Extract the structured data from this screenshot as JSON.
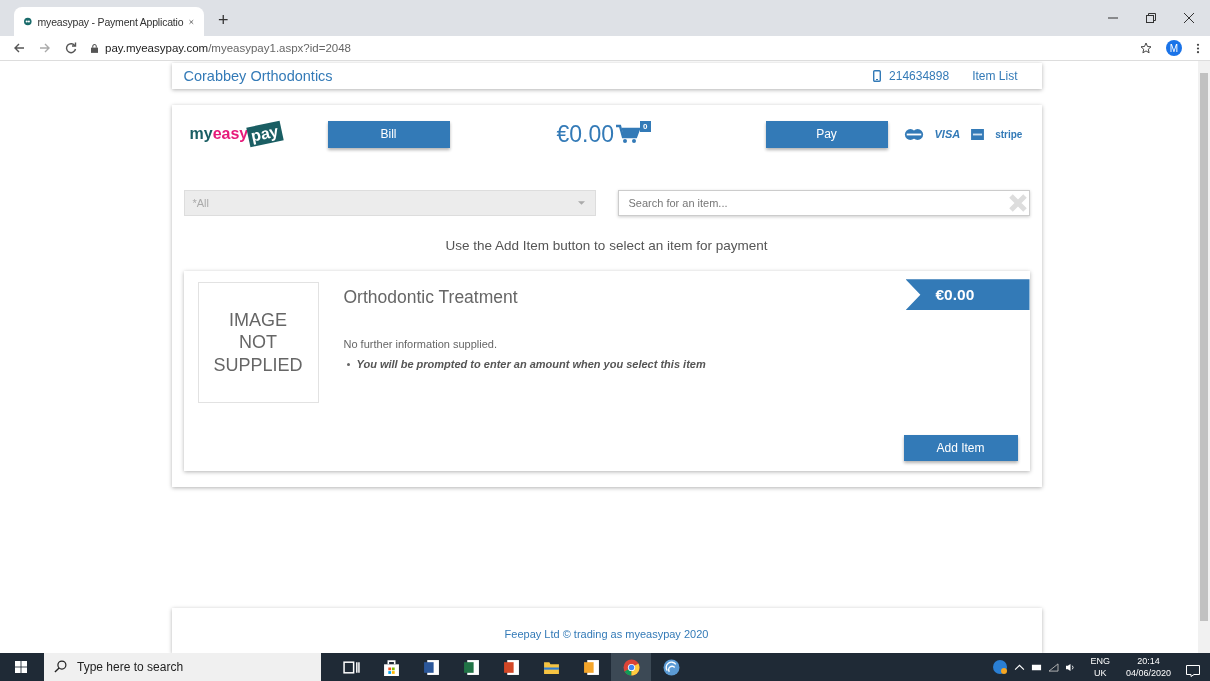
{
  "browser": {
    "tab": {
      "title": "myeasypay - Payment Applicatio",
      "selected": true
    },
    "new_tab": "+",
    "url": {
      "host": "pay.myeasypay.com",
      "path": "/myeasypay1.aspx?id=2048"
    },
    "profile": "M"
  },
  "header": {
    "business": "Corabbey Orthodontics",
    "phone": "214634898",
    "item_list": "Item List"
  },
  "toolbar": {
    "logo": [
      "my",
      "easy",
      "pay"
    ],
    "bill": "Bill",
    "total": "€0.00",
    "cart_count": "0",
    "pay": "Pay",
    "card_labels": [
      "VISA",
      "stripe"
    ]
  },
  "filter": {
    "category": "*All",
    "search_placeholder": "Search for an item..."
  },
  "hint": "Use the Add Item button to select an item for payment",
  "items": [
    {
      "image_text": [
        "IMAGE",
        "NOT",
        "SUPPLIED"
      ],
      "title": "Orthodontic Treatment",
      "price": "€0.00",
      "info": "No further information supplied.",
      "notes": [
        "You will be prompted to enter an amount when you select this item"
      ],
      "button": "Add Item"
    }
  ],
  "footer": {
    "copyright": "Feepay Ltd © trading as myeasypay 2020"
  },
  "taskbar": {
    "search_placeholder": "Type here to search",
    "apps": [
      {
        "kind": "taskview",
        "selected": false
      },
      {
        "kind": "store",
        "selected": false
      },
      {
        "kind": "word",
        "selected": false
      },
      {
        "kind": "excel",
        "selected": false
      },
      {
        "kind": "powerpoint",
        "selected": false
      },
      {
        "kind": "files",
        "selected": false
      },
      {
        "kind": "outlook",
        "selected": false
      },
      {
        "kind": "chrome",
        "selected": true
      },
      {
        "kind": "network",
        "selected": false
      }
    ],
    "language": [
      "ENG",
      "UK"
    ],
    "time": "20:14",
    "date": "04/06/2020"
  }
}
